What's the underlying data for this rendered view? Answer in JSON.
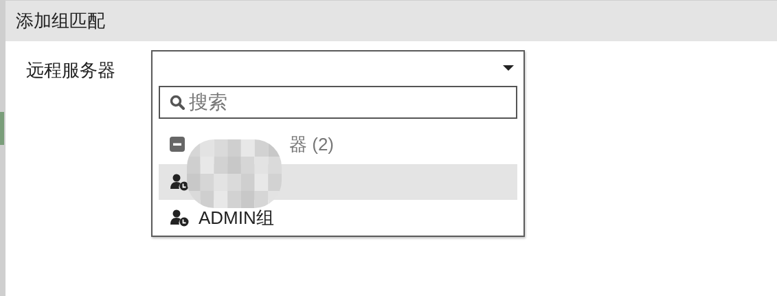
{
  "dialog": {
    "title": "添加组匹配"
  },
  "field": {
    "label": "远程服务器"
  },
  "dropdown": {
    "open": true,
    "search": {
      "placeholder": "搜索"
    },
    "obscured": true,
    "group": {
      "expanded": true,
      "label_end": "器 (2)"
    },
    "items": [
      {
        "highlighted": true
      },
      {
        "highlighted": false,
        "label": "ADMIN组"
      }
    ]
  }
}
